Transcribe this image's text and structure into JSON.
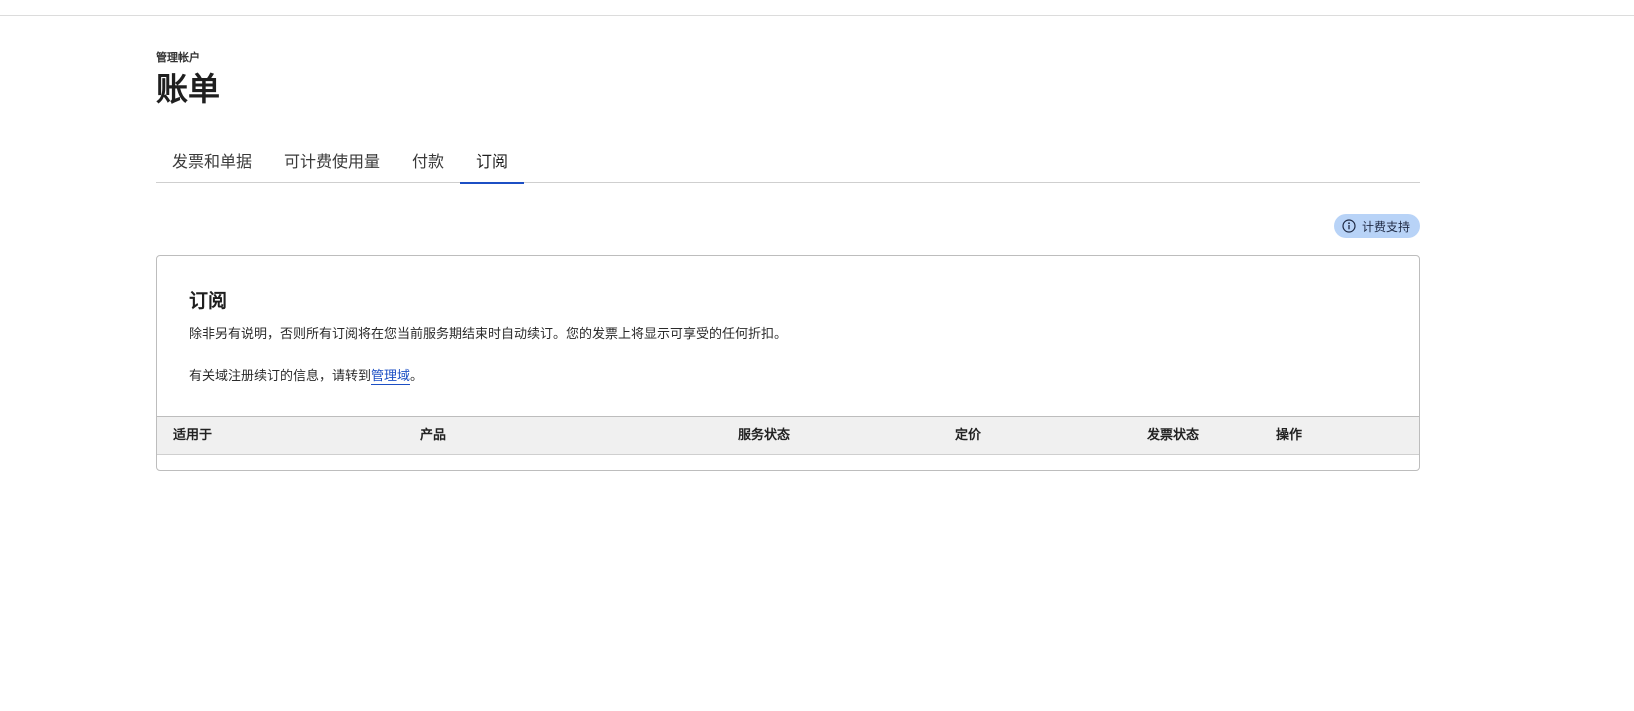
{
  "header": {
    "breadcrumb": "管理帐户",
    "title": "账单"
  },
  "tabs": [
    {
      "label": "发票和单据",
      "active": false
    },
    {
      "label": "可计费使用量",
      "active": false
    },
    {
      "label": "付款",
      "active": false
    },
    {
      "label": "订阅",
      "active": true
    }
  ],
  "support": {
    "label": "计费支持",
    "icon": "info-icon"
  },
  "subscriptions": {
    "title": "订阅",
    "description": "除非另有说明，否则所有订阅将在您当前服务期结束时自动续订。您的发票上将显示可享受的任何折扣。",
    "domain_note_prefix": "有关域注册续订的信息，请转到",
    "domain_link": "管理域",
    "domain_note_suffix": "。",
    "columns": [
      "适用于",
      "产品",
      "服务状态",
      "定价",
      "发票状态",
      "操作"
    ]
  },
  "colors": {
    "accent": "#1c4fc4",
    "pill_bg": "#b8d3f7",
    "table_header_bg": "#f0f0f0"
  }
}
